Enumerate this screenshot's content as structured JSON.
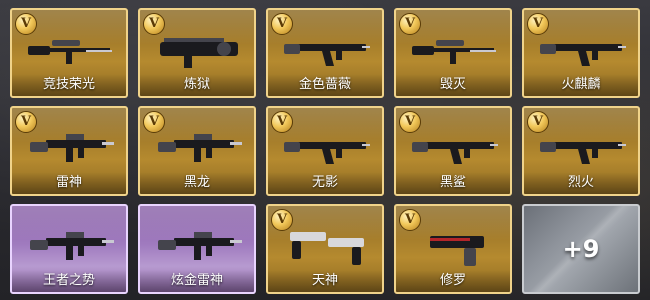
{
  "badge_letter": "V",
  "weapons": [
    {
      "name": "竞技荣光",
      "rarity": "gold",
      "icon": "sniper-rifle-icon"
    },
    {
      "name": "炼狱",
      "rarity": "gold",
      "icon": "gatling-gun-icon"
    },
    {
      "name": "金色蔷薇",
      "rarity": "gold",
      "icon": "assault-rifle-icon"
    },
    {
      "name": "毁灭",
      "rarity": "gold",
      "icon": "sniper-rifle-icon"
    },
    {
      "name": "火麒麟",
      "rarity": "gold",
      "icon": "assault-rifle-icon"
    },
    {
      "name": "雷神",
      "rarity": "gold",
      "icon": "carbine-icon"
    },
    {
      "name": "黑龙",
      "rarity": "gold",
      "icon": "carbine-icon"
    },
    {
      "name": "无影",
      "rarity": "gold",
      "icon": "assault-rifle-icon"
    },
    {
      "name": "黑鲨",
      "rarity": "gold",
      "icon": "assault-rifle-icon"
    },
    {
      "name": "烈火",
      "rarity": "gold",
      "icon": "assault-rifle-icon"
    },
    {
      "name": "王者之势",
      "rarity": "purple",
      "icon": "carbine-icon"
    },
    {
      "name": "炫金雷神",
      "rarity": "purple",
      "icon": "carbine-icon"
    },
    {
      "name": "天神",
      "rarity": "gold",
      "icon": "dual-pistols-icon"
    },
    {
      "name": "修罗",
      "rarity": "gold",
      "icon": "pistol-icon"
    }
  ],
  "more_tile": {
    "label": "+9"
  },
  "colors": {
    "gold": "#b58a2f",
    "purple": "#a07bbf",
    "grey": "#8e939b"
  }
}
